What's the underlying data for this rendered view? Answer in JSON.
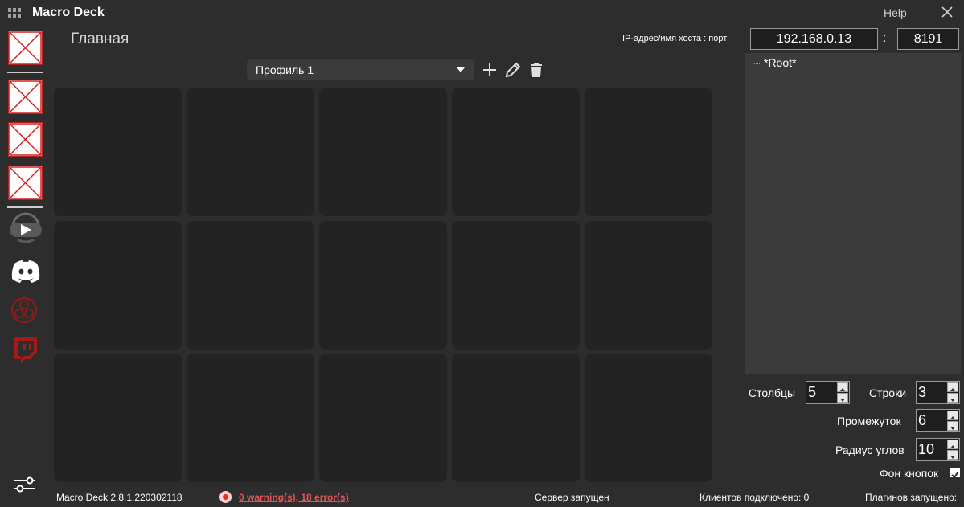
{
  "window": {
    "title": "Macro Deck",
    "help": "Help"
  },
  "main": {
    "title": "Главная"
  },
  "connection": {
    "host_label": "IP-адрес/имя хоста : порт",
    "ip": "192.168.0.13",
    "separator": ":",
    "port": "8191"
  },
  "profile": {
    "selected": "Профиль 1"
  },
  "tree": {
    "root": "*Root*"
  },
  "settings": {
    "columns_label": "Столбцы",
    "columns_value": "5",
    "rows_label": "Строки",
    "rows_value": "3",
    "spacing_label": "Промежуток",
    "spacing_value": "6",
    "radius_label": "Радиус углов",
    "radius_value": "10",
    "background_label": "Фон кнопок",
    "background_checked": true
  },
  "status": {
    "version": "Macro Deck 2.8.1.220302118",
    "errors": "0 warning(s), 18 error(s)",
    "server": "Сервер запущен",
    "clients": "Клиентов подключено: 0",
    "plugins": "Плагинов запущено:"
  },
  "sidebar": {
    "icons": [
      "broken-image-icon",
      "broken-image-icon",
      "broken-image-icon",
      "broken-image-icon",
      "play-icon",
      "discord-icon",
      "obs-icon",
      "twitch-icon",
      "settings-sliders-icon"
    ]
  },
  "colors": {
    "background": "#2d2d2d",
    "panel": "#3b3b3b",
    "cell": "#232323",
    "error": "#e05555",
    "broken_border": "#b22222"
  }
}
